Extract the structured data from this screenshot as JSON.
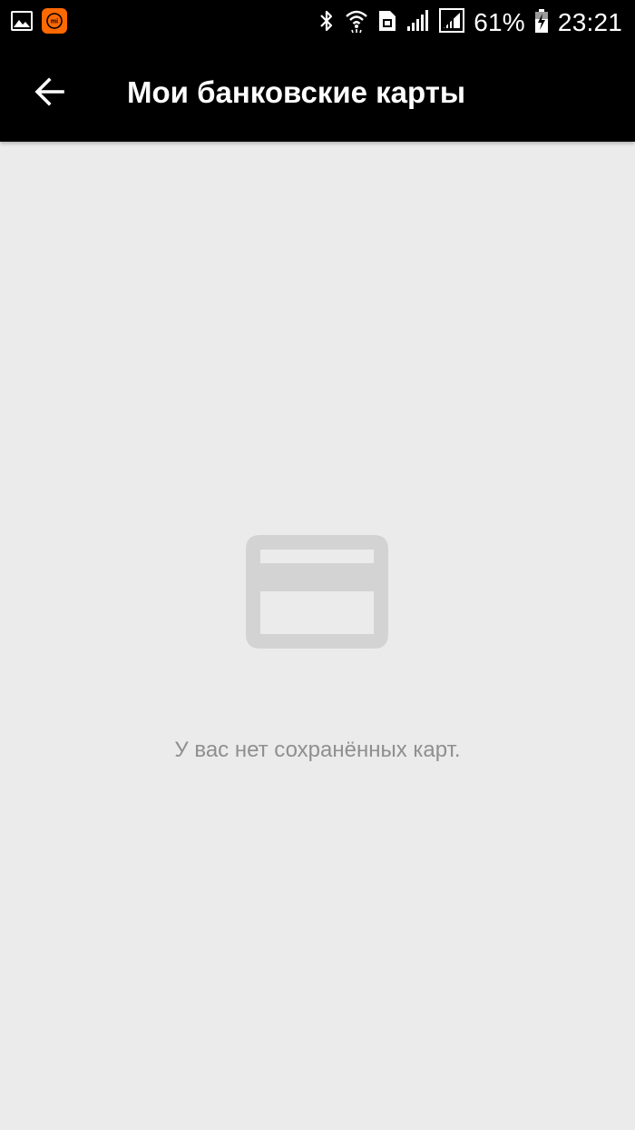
{
  "status_bar": {
    "battery_percent": "61%",
    "time": "23:21",
    "icons": [
      "gallery-icon",
      "mi-app-icon",
      "bluetooth-icon",
      "wifi-icon",
      "sim-icon",
      "signal-icon",
      "signal-icon-2",
      "battery-charging-icon"
    ],
    "mi_app_color": "#ff6900"
  },
  "app_bar": {
    "title": "Мои банковские карты",
    "back_icon": "arrow-left-icon"
  },
  "empty_state": {
    "icon": "credit-card-icon",
    "icon_color": "#d3d3d3",
    "message": "У вас нет сохранённых карт."
  }
}
